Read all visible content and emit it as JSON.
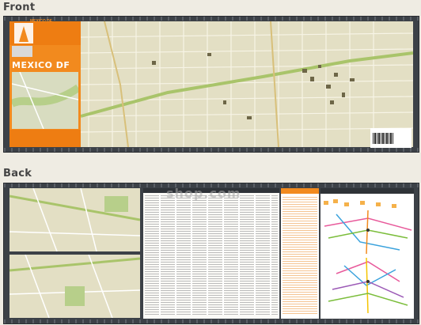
{
  "sections": {
    "front_label": "Front",
    "back_label": "Back"
  },
  "front": {
    "cover_title": "MEXICO DF",
    "brand": "MEXICO DF"
  },
  "watermark": "shop.com",
  "colors": {
    "panel": "#3c4147",
    "map_base": "#e3dfc4",
    "park_green": "#b7cf8a",
    "main_road": "#a9c46a",
    "cover_orange": "#f28a1e",
    "index_orange": "#f28a1e"
  }
}
